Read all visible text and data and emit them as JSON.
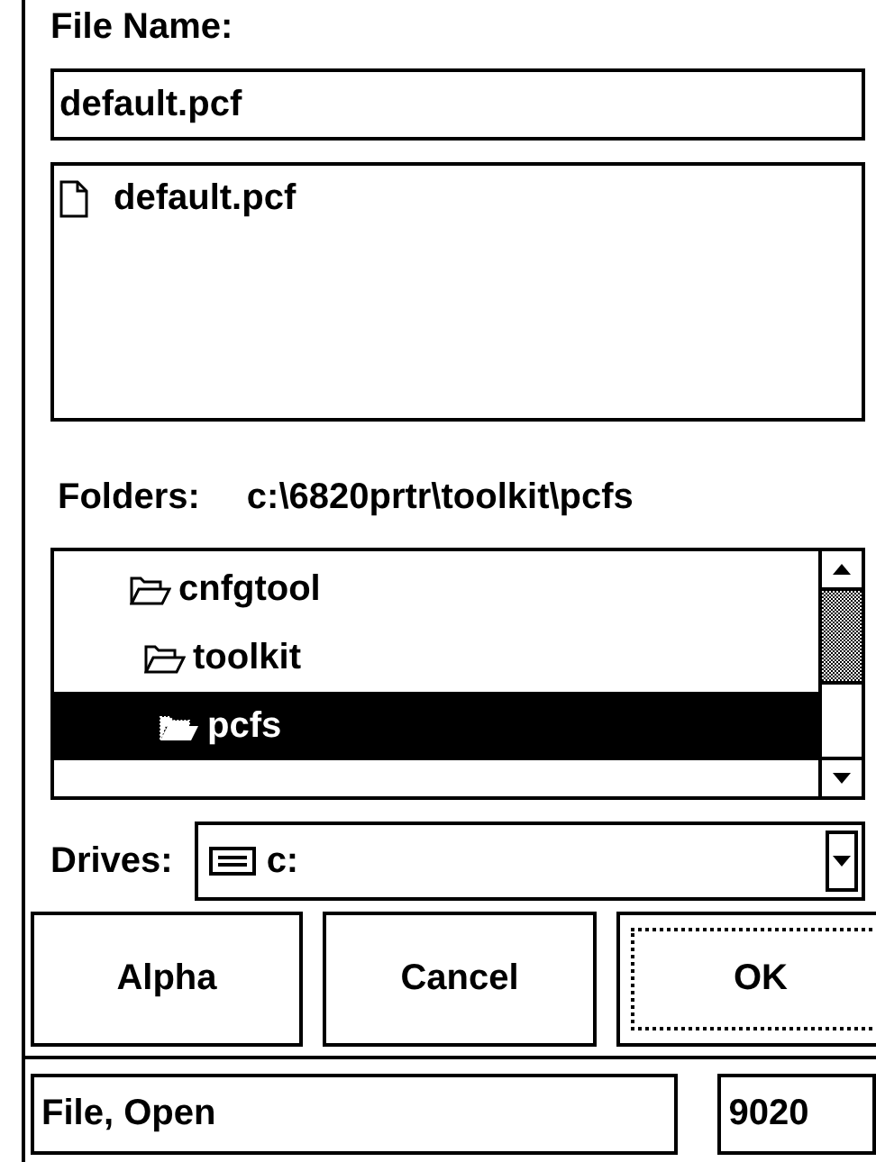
{
  "file_name": {
    "label": "File Name:",
    "value": "default.pcf"
  },
  "files": [
    {
      "name": "default.pcf",
      "selected": false
    }
  ],
  "folders": {
    "label": "Folders:",
    "path": "c:\\6820prtr\\toolkit\\pcfs",
    "tree": [
      {
        "name": "cnfgtool",
        "selected": false,
        "children": [
          {
            "name": "toolkit",
            "selected": false,
            "children": [
              {
                "name": "pcfs",
                "selected": true
              }
            ]
          }
        ]
      }
    ]
  },
  "drives": {
    "label": "Drives:",
    "value": "c:"
  },
  "buttons": [
    {
      "label": "Alpha",
      "focused": false
    },
    {
      "label": "Cancel",
      "focused": false
    },
    {
      "label": "OK",
      "focused": true
    }
  ],
  "status_bar": {
    "message": "File, Open",
    "code": "9020"
  }
}
